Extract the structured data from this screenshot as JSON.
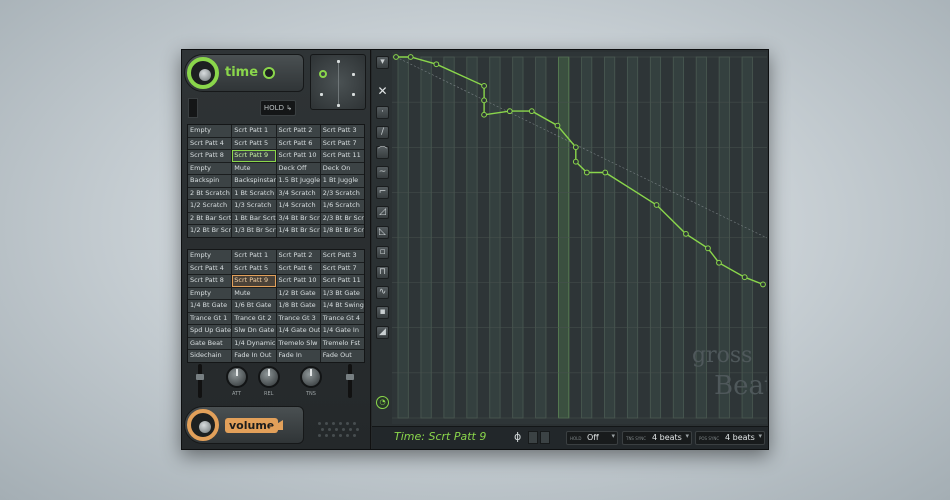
{
  "time_module": {
    "title": "time",
    "hold_label": "HOLD"
  },
  "time_presets": [
    "Empty",
    "Scrt Patt 1",
    "Scrt Patt 2",
    "Scrt Patt 3",
    "Scrt Patt 4",
    "Scrt Patt 5",
    "Scrt Patt 6",
    "Scrt Patt 7",
    "Scrt Patt 8",
    "Scrt Patt 9",
    "Scrt Patt 10",
    "Scrt Patt 11",
    "Empty",
    "Mute",
    "Deck Off",
    "Deck On",
    "Backspin",
    "Backspinstart",
    "1.5 Bt Juggle",
    "1 Bt Juggle",
    "2 Bt Scratch",
    "1 Bt Scratch",
    "3/4 Scratch",
    "2/3 Scratch",
    "1/2 Scratch",
    "1/3 Scratch",
    "1/4 Scratch",
    "1/6 Scratch",
    "2 Bt Bar Scrt",
    "1 Bt Bar Scrt",
    "3/4 Bt Br Scrt",
    "2/3 Bt Br Scrt",
    "1/2 Bt Br Scrt",
    "1/3 Bt Br Scrt",
    "1/4 Bt Br Scrt",
    "1/8 Bt Br Scrt"
  ],
  "time_selected_index": 9,
  "volume_presets": [
    "Empty",
    "Scrt Patt 1",
    "Scrt Patt 2",
    "Scrt Patt 3",
    "Scrt Patt 4",
    "Scrt Patt 5",
    "Scrt Patt 6",
    "Scrt Patt 7",
    "Scrt Patt 8",
    "Scrt Patt 9",
    "Scrt Patt 10",
    "Scrt Patt 11",
    "Empty",
    "Mute",
    "1/2 Bt Gate",
    "1/3 Bt Gate",
    "1/4 Bt Gate",
    "1/6 Bt Gate",
    "1/8 Bt Gate",
    "1/4 Bt Swing",
    "Trance Gt 1",
    "Trance Gt 2",
    "Trance Gt 3",
    "Trance Gt 4",
    "Spd Up Gate",
    "Slw Dn Gate",
    "1/4 Gate Out",
    "1/4 Gate In",
    "Gate Beat",
    "1/4 Dynamic",
    "Tremelo Slw",
    "Tremelo Fst",
    "Sidechain",
    "Fade In Out",
    "Fade In",
    "Fade Out"
  ],
  "volume_selected_index": 9,
  "knobs": {
    "att_label": "ATT",
    "rel_label": "REL",
    "tns_label": "TNS"
  },
  "volume_module": {
    "title": "volume"
  },
  "status": {
    "text": "Time: Scrt Patt 9",
    "hold_label": "HOLD",
    "hold_value": "Off",
    "tns_label": "TNS SYNC",
    "tns_value": "4 beats",
    "pos_label": "POS SYNC",
    "pos_value": "4 beats"
  },
  "watermark": "gross Beat",
  "colors": {
    "time_accent": "#8ad64b",
    "volume_accent": "#e2a05a",
    "graph_bg": "#2e3537"
  },
  "envelope": {
    "x_range": [
      0,
      1
    ],
    "y_range": [
      0,
      1
    ],
    "y_grid_lines": 8,
    "x_grid_lines": 16,
    "points": [
      [
        0.0,
        0.0
      ],
      [
        0.04,
        0.0
      ],
      [
        0.11,
        0.02
      ],
      [
        0.24,
        0.08
      ],
      [
        0.24,
        0.12
      ],
      [
        0.24,
        0.16
      ],
      [
        0.31,
        0.15
      ],
      [
        0.37,
        0.15
      ],
      [
        0.44,
        0.19
      ],
      [
        0.49,
        0.25
      ],
      [
        0.49,
        0.29
      ],
      [
        0.52,
        0.32
      ],
      [
        0.57,
        0.32
      ],
      [
        0.71,
        0.41
      ],
      [
        0.79,
        0.49
      ],
      [
        0.85,
        0.53
      ],
      [
        0.88,
        0.57
      ],
      [
        0.95,
        0.61
      ],
      [
        1.0,
        0.63
      ]
    ]
  }
}
